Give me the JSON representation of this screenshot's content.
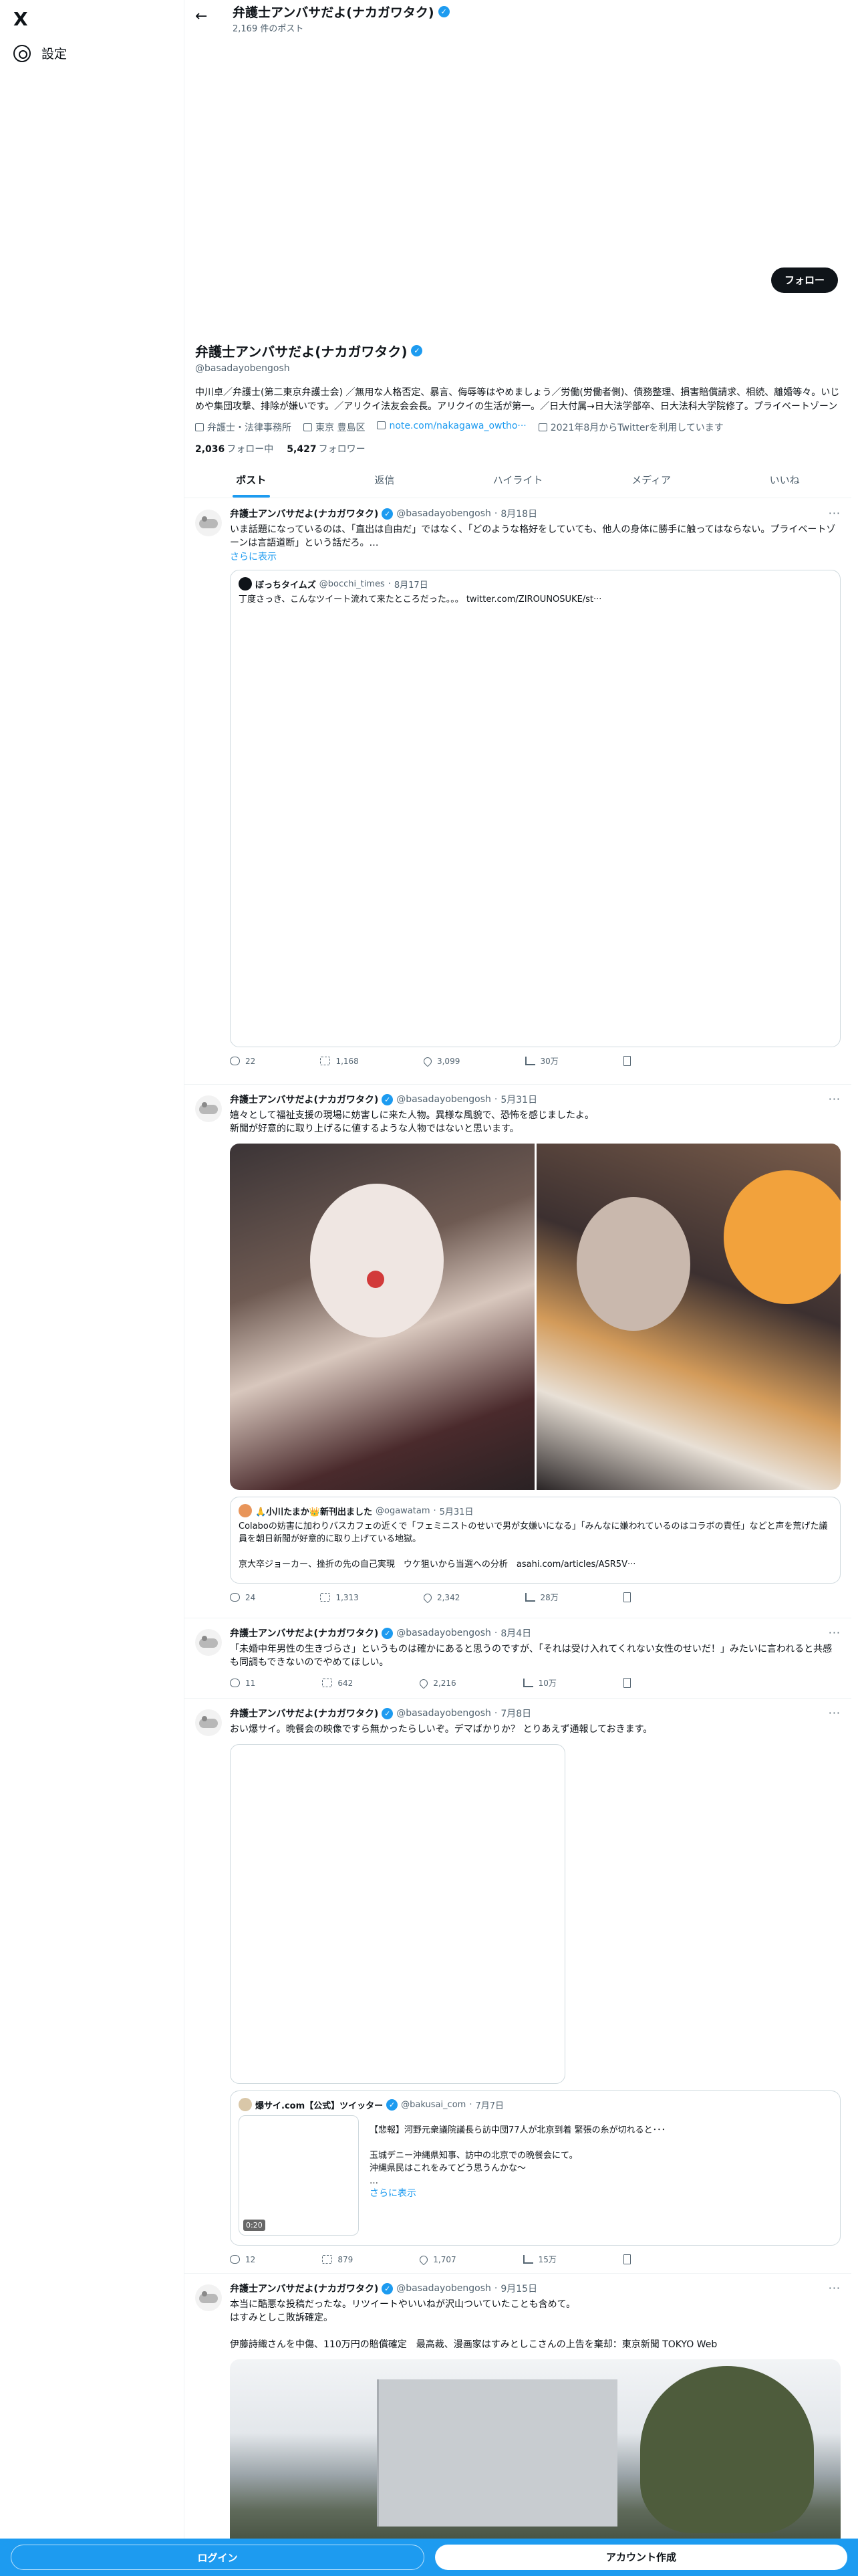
{
  "nav": {
    "logo": "X",
    "settings_label": "設定"
  },
  "topbar": {
    "name": "弁護士アンバサだよ(ナカガワタク)",
    "post_count": "2,169 件のポスト"
  },
  "profile": {
    "follow_button": "フォロー",
    "name": "弁護士アンバサだよ(ナカガワタク)",
    "handle": "@basadayobengosh",
    "bio": "中川卓／弁護士(第二東京弁護士会) ／無用な人格否定、暴言、侮辱等はやめましょう／労働(労働者側)、債務整理、損害賠償請求、相続、離婚等々。いじめや集団攻撃、排除が嫌いです。／アリクイ法友会会長。アリクイの生活が第一。／日大付属→日大法学部卒、日大法科大学院修了。プライベートゾーンは言語道断」という話だろ。…",
    "occupation": "弁護士・法律事務所",
    "location": "東京 豊島区",
    "link": "note.com/nakagawa_owtho···",
    "joined": "2021年8月からTwitterを利用しています",
    "following_count": "2,036",
    "following_label": "フォロー中",
    "followers_count": "5,427",
    "followers_label": "フォロワー"
  },
  "tabs": [
    "ポスト",
    "返信",
    "ハイライト",
    "メディア",
    "いいね"
  ],
  "tweets": [
    {
      "name": "弁護士アンバサだよ(ナカガワタク)",
      "handle": "@basadayobengosh",
      "date": "8月18日",
      "text": "いま話題になっているのは、「直出は自由だ」ではなく、「どのような格好をしていても、他人の身体に勝手に触ってはならない。プライベートゾーンは言語道断」という話だろ。…",
      "show_more": "さらに表示",
      "quote": {
        "name": "ぼっちタイムズ",
        "handle": "@bocchi_times",
        "date": "8月17日",
        "text": "丁度さっき、こんなツイート流れて来たところだった。。。 twitter.com/ZIROUNOSUKE/st···"
      },
      "replies": "22",
      "reposts": "1,168",
      "likes": "3,099",
      "views": "30万"
    },
    {
      "name": "弁護士アンバサだよ(ナカガワタク)",
      "handle": "@basadayobengosh",
      "date": "5月31日",
      "text": "嬉々として福祉支援の現場に妨害しに来た人物。異様な風貌で、恐怖を感じましたよ。\n新聞が好意的に取り上げるに値するような人物ではないと思います。",
      "quote": {
        "name": "🙏小川たまか👑新刊出ました",
        "handle": "@ogawatam",
        "date": "5月31日",
        "text": "Colaboの妨害に加わりバスカフェの近くで「フェミニストのせいで男が女嫌いになる」「みんなに嫌われているのはコラボの責任」などと声を荒げた議員を朝日新聞が好意的に取り上げている地獄。\n\n京大卒ジョーカー、挫折の先の自己実現　ウケ狙いから当選への分析　asahi.com/articles/ASR5V···"
      },
      "replies": "24",
      "reposts": "1,313",
      "likes": "2,342",
      "views": "28万"
    },
    {
      "name": "弁護士アンバサだよ(ナカガワタク)",
      "handle": "@basadayobengosh",
      "date": "8月4日",
      "text": "「未婚中年男性の生きづらさ」というものは確かにあると思うのですが、「それは受け入れてくれない女性のせいだ！」みたいに言われると共感も同調もできないのでやめてほしい。",
      "replies": "11",
      "reposts": "642",
      "likes": "2,216",
      "views": "10万"
    },
    {
      "name": "弁護士アンバサだよ(ナカガワタク)",
      "handle": "@basadayobengosh",
      "date": "7月8日",
      "text": "おい爆サイ。晩餐会の映像ですら無かったらしいぞ。デマばかりか？ とりあえず通報しておきます。",
      "quote": {
        "name": "爆サイ.com【公式】ツイッター",
        "handle": "@bakusai_com",
        "date": "7月7日",
        "text": "【悲報】河野元衆議院議長ら訪中団77人が北京到着 緊張の糸が切れると･･･\n\n玉城デニー沖縄県知事、訪中の北京での晩餐会にて。\n沖縄県民はこれをみてどう思うんかな〜\n…",
        "show_more": "さらに表示",
        "duration": "0:20"
      },
      "replies": "12",
      "reposts": "879",
      "likes": "1,707",
      "views": "15万"
    },
    {
      "name": "弁護士アンバサだよ(ナカガワタク)",
      "handle": "@basadayobengosh",
      "date": "9月15日",
      "text": "本当に酷悪な投稿だったな。リツイートやいいねが沢山ついていたことも含めて。\nはすみとしこ敗訴確定。\n\n伊藤詩織さんを中傷、110万円の賠償確定　最高裁、漫画家はすみとしこさんの上告を棄却：東京新聞 TOKYO Web"
    }
  ],
  "bottom_bar": {
    "login": "ログイン",
    "signup": "アカウント作成"
  },
  "colors": {
    "accent": "#1d9bf0",
    "text": "#0f1419",
    "muted": "#536471"
  }
}
